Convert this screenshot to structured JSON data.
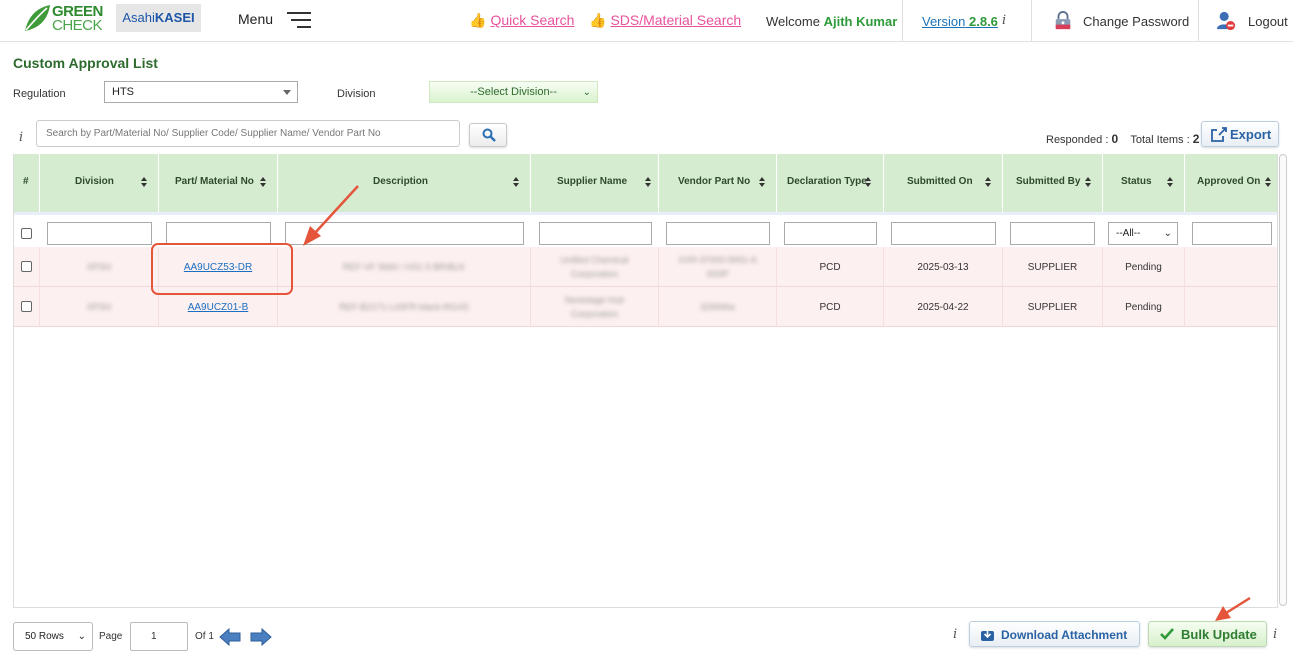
{
  "header": {
    "logo_line1": "GREEN",
    "logo_line2": "CHECK",
    "brand_prefix": "Asahi",
    "brand_suffix": "KASEI",
    "menu_label": "Menu",
    "quick_search": "Quick Search",
    "sds_search": "SDS/Material Search",
    "welcome_prefix": "Welcome",
    "user_name": "Ajith Kumar",
    "version_prefix": "Version",
    "version_number": "2.8.6",
    "info_glyph": "i",
    "change_password": "Change Password",
    "logout": "Logout"
  },
  "page": {
    "title": "Custom Approval List",
    "regulation_label": "Regulation",
    "regulation_value": "HTS",
    "division_label": "Division",
    "division_value": "--Select Division--",
    "search_placeholder": "Search by Part/Material No/ Supplier Code/ Supplier Name/ Vendor Part No",
    "responded_label": "Responded :",
    "responded_value": "0",
    "total_label": "Total Items :",
    "total_value": "2",
    "export_label": "Export"
  },
  "table": {
    "columns": [
      "#",
      "Division",
      "Part/ Material No",
      "Description",
      "Supplier Name",
      "Vendor Part No",
      "Declaration Type",
      "Submitted On",
      "Submitted By",
      "Status",
      "Approved On"
    ],
    "status_filter": "--All--",
    "rows": [
      {
        "division": "XPSH",
        "part_no": "AA9UCZ53-DR",
        "description": "REF-VF 9660 / HS1 5 BR/BLK",
        "supplier_line1": "Unified Chemical",
        "supplier_line2": "Corporation",
        "vendor_line1": "XXR-37000-9991-A",
        "vendor_line2": "0ISIP",
        "declaration_type": "PCD",
        "submitted_on": "2025-03-13",
        "submitted_by": "SUPPLIER",
        "status": "Pending",
        "approved_on": ""
      },
      {
        "division": "XPSH",
        "part_no": "AA9UCZ01-B",
        "description": "REF-B2171-L43FR-black-lf414S",
        "supplier_line1": "Nextstage Hub",
        "supplier_line2": "Corporation",
        "vendor_line1": "3299/the",
        "vendor_line2": "",
        "declaration_type": "PCD",
        "submitted_on": "2025-04-22",
        "submitted_by": "SUPPLIER",
        "status": "Pending",
        "approved_on": ""
      }
    ]
  },
  "footer": {
    "rows_per_page": "50 Rows",
    "page_label": "Page",
    "page_value": "1",
    "of_label": "Of 1",
    "download_label": "Download Attachment",
    "bulk_label": "Bulk Update"
  },
  "colors": {
    "brand_green": "#2e8a2e",
    "link_pink": "#e8529c",
    "header_bg": "#d6ecd0",
    "row_bg": "#fdf0f0",
    "link_blue": "#1a6fc2",
    "annotation_red": "#e4553c"
  }
}
